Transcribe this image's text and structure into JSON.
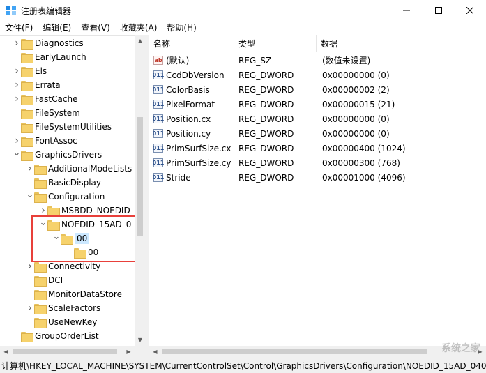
{
  "window": {
    "title": "注册表编辑器"
  },
  "menu": [
    "文件(F)",
    "编辑(E)",
    "查看(V)",
    "收藏夹(A)",
    "帮助(H)"
  ],
  "tree": [
    {
      "label": "Diagnostics",
      "depth": 1,
      "arrow": "collapsed"
    },
    {
      "label": "EarlyLaunch",
      "depth": 1,
      "arrow": "none"
    },
    {
      "label": "Els",
      "depth": 1,
      "arrow": "collapsed"
    },
    {
      "label": "Errata",
      "depth": 1,
      "arrow": "collapsed"
    },
    {
      "label": "FastCache",
      "depth": 1,
      "arrow": "collapsed"
    },
    {
      "label": "FileSystem",
      "depth": 1,
      "arrow": "none"
    },
    {
      "label": "FileSystemUtilities",
      "depth": 1,
      "arrow": "none"
    },
    {
      "label": "FontAssoc",
      "depth": 1,
      "arrow": "collapsed"
    },
    {
      "label": "GraphicsDrivers",
      "depth": 1,
      "arrow": "expanded"
    },
    {
      "label": "AdditionalModeLists",
      "depth": 2,
      "arrow": "collapsed"
    },
    {
      "label": "BasicDisplay",
      "depth": 2,
      "arrow": "none"
    },
    {
      "label": "Configuration",
      "depth": 2,
      "arrow": "expanded"
    },
    {
      "label": "MSBDD_NOEDID",
      "depth": 3,
      "arrow": "collapsed"
    },
    {
      "label": "NOEDID_15AD_0",
      "depth": 3,
      "arrow": "expanded"
    },
    {
      "label": "00",
      "depth": 4,
      "arrow": "expanded",
      "selected": true
    },
    {
      "label": "00",
      "depth": 5,
      "arrow": "none"
    },
    {
      "label": "Connectivity",
      "depth": 2,
      "arrow": "collapsed"
    },
    {
      "label": "DCI",
      "depth": 2,
      "arrow": "none"
    },
    {
      "label": "MonitorDataStore",
      "depth": 2,
      "arrow": "none"
    },
    {
      "label": "ScaleFactors",
      "depth": 2,
      "arrow": "collapsed"
    },
    {
      "label": "UseNewKey",
      "depth": 2,
      "arrow": "none"
    },
    {
      "label": "GroupOrderList",
      "depth": 1,
      "arrow": "none"
    }
  ],
  "columns": {
    "name": "名称",
    "type": "类型",
    "data": "数据"
  },
  "values": [
    {
      "icon": "string-value-icon",
      "badge": "ab",
      "name": "(默认)",
      "type": "REG_SZ",
      "data": "(数值未设置)"
    },
    {
      "icon": "binary-value-icon",
      "badge": "011",
      "name": "CcdDbVersion",
      "type": "REG_DWORD",
      "data": "0x00000000 (0)"
    },
    {
      "icon": "binary-value-icon",
      "badge": "011",
      "name": "ColorBasis",
      "type": "REG_DWORD",
      "data": "0x00000002 (2)"
    },
    {
      "icon": "binary-value-icon",
      "badge": "011",
      "name": "PixelFormat",
      "type": "REG_DWORD",
      "data": "0x00000015 (21)"
    },
    {
      "icon": "binary-value-icon",
      "badge": "011",
      "name": "Position.cx",
      "type": "REG_DWORD",
      "data": "0x00000000 (0)"
    },
    {
      "icon": "binary-value-icon",
      "badge": "011",
      "name": "Position.cy",
      "type": "REG_DWORD",
      "data": "0x00000000 (0)"
    },
    {
      "icon": "binary-value-icon",
      "badge": "011",
      "name": "PrimSurfSize.cx",
      "type": "REG_DWORD",
      "data": "0x00000400 (1024)"
    },
    {
      "icon": "binary-value-icon",
      "badge": "011",
      "name": "PrimSurfSize.cy",
      "type": "REG_DWORD",
      "data": "0x00000300 (768)"
    },
    {
      "icon": "binary-value-icon",
      "badge": "011",
      "name": "Stride",
      "type": "REG_DWORD",
      "data": "0x00001000 (4096)"
    }
  ],
  "status": {
    "path": "计算机\\HKEY_LOCAL_MACHINE\\SYSTEM\\CurrentControlSet\\Control\\GraphicsDrivers\\Configuration\\NOEDID_15AD_040"
  },
  "watermark": "系统之家",
  "colors": {
    "highlight": "#e8403a",
    "selection": "#cce8ff",
    "folder": "#f6d26c"
  }
}
